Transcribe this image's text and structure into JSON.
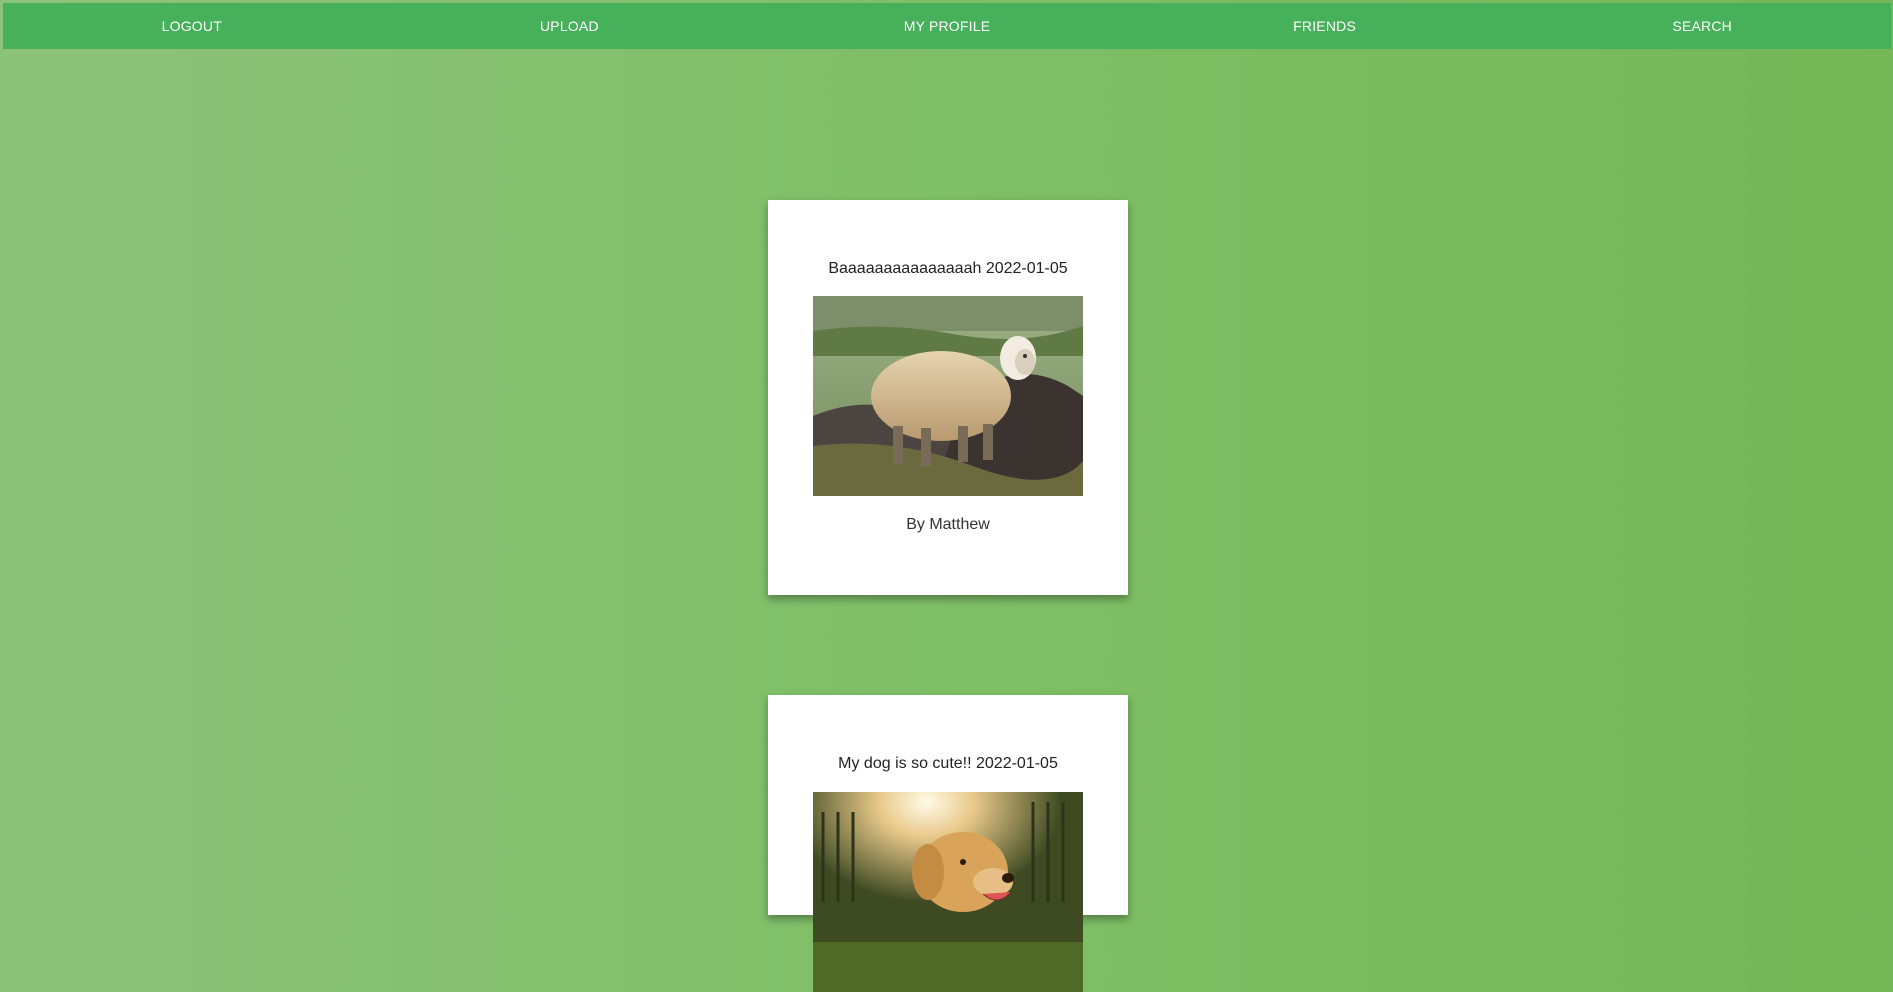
{
  "nav": {
    "items": [
      {
        "label": "LOGOUT"
      },
      {
        "label": "UPLOAD"
      },
      {
        "label": "MY PROFILE"
      },
      {
        "label": "FRIENDS"
      },
      {
        "label": "SEARCH"
      }
    ]
  },
  "posts": [
    {
      "caption": "Baaaaaaaaaaaaaaah 2022-01-05",
      "author": "By Matthew",
      "image_icon": "sheep-photo"
    },
    {
      "caption": "My dog is so cute!! 2022-01-05",
      "author": "",
      "image_icon": "dog-photo"
    }
  ],
  "colors": {
    "nav_bg": "#47b05a",
    "page_bg_left": "#8cc27a",
    "page_bg_right": "#75b757",
    "card_bg": "#ffffff"
  }
}
